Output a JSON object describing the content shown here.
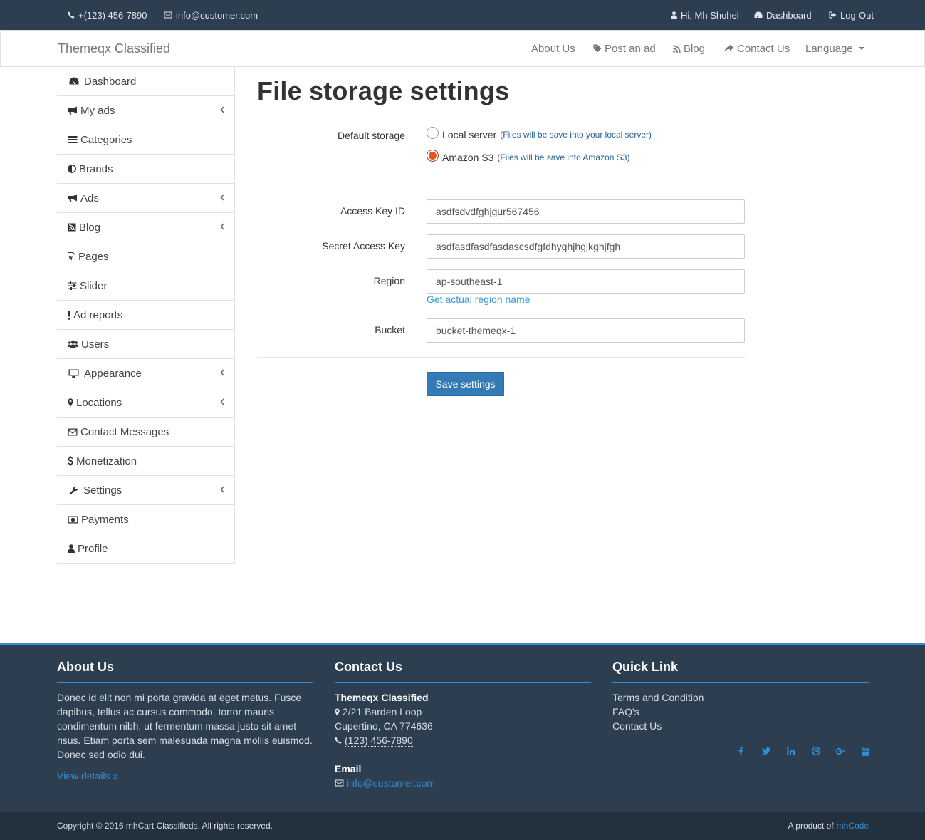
{
  "topbar": {
    "phone": "+(123) 456-7890",
    "email": "info@customer.com",
    "greeting": "Hi, Mh Shohel",
    "dashboard": "Dashboard",
    "logout": "Log-Out"
  },
  "navbar": {
    "brand": "Themeqx Classified",
    "about": "About Us",
    "post_ad": "Post an ad",
    "blog": "Blog",
    "contact": "Contact Us",
    "language": "Language"
  },
  "sidebar": {
    "items": [
      {
        "label": "Dashboard",
        "icon": "dashboard-icon"
      },
      {
        "label": "My ads",
        "icon": "bullhorn-icon"
      },
      {
        "label": "Categories",
        "icon": "list-icon"
      },
      {
        "label": "Brands",
        "icon": "adjust-icon"
      },
      {
        "label": "Ads",
        "icon": "bullhorn-icon"
      },
      {
        "label": "Blog",
        "icon": "rss-icon"
      },
      {
        "label": "Pages",
        "icon": "file-word-icon"
      },
      {
        "label": "Slider",
        "icon": "sliders-icon"
      },
      {
        "label": "Ad reports",
        "icon": "exclamation-icon"
      },
      {
        "label": "Users",
        "icon": "users-icon"
      },
      {
        "label": "Appearance",
        "icon": "desktop-icon"
      },
      {
        "label": "Locations",
        "icon": "map-marker-icon"
      },
      {
        "label": "Contact Messages",
        "icon": "envelope-icon"
      },
      {
        "label": "Monetization",
        "icon": "dollar-icon"
      },
      {
        "label": "Settings",
        "icon": "wrench-icon"
      },
      {
        "label": "Payments",
        "icon": "money-icon"
      },
      {
        "label": "Profile",
        "icon": "user-icon"
      }
    ]
  },
  "main": {
    "title": "File storage settings",
    "default_storage_label": "Default storage",
    "local_label": "Local server",
    "local_hint": "(Files will be save into your local server)",
    "s3_label": "Amazon S3",
    "s3_hint": "(Files will be save into Amazon S3)",
    "selected_storage": "Amazon S3",
    "access_key_label": "Access Key ID",
    "access_key_value": "asdfsdvdfghjgur567456",
    "secret_key_label": "Secret Access Key",
    "secret_key_value": "asdfasdfasdfasdascsdfgfdhyghjhgjkghjfgh",
    "region_label": "Region",
    "region_value": "ap-southeast-1",
    "region_help": "Get actual region name",
    "bucket_label": "Bucket",
    "bucket_value": "bucket-themeqx-1",
    "save_button": "Save settings"
  },
  "footer": {
    "about_title": "About Us",
    "about_text": "Donec id elit non mi porta gravida at eget metus. Fusce dapibus, tellus ac cursus commodo, tortor mauris condimentum nibh, ut fermentum massa justo sit amet risus. Etiam porta sem malesuada magna mollis euismod. Donec sed odio dui.",
    "about_link": "View details »",
    "contact_title": "Contact Us",
    "company": "Themeqx Classified",
    "address1": "2/21 Barden Loop",
    "address2": "Cupertino, CA 774636",
    "phone": "(123) 456-7890",
    "email_heading": "Email",
    "email": "info@customer.com",
    "quick_title": "Quick Link",
    "quick_links": [
      "Terms and Condition",
      "FAQ's",
      "Contact Us"
    ],
    "socials": [
      "facebook-icon",
      "twitter-icon",
      "linkedin-icon",
      "dribbble-icon",
      "google-plus-icon",
      "youtube-icon"
    ],
    "copyright": "Copyright © 2016 mhCart Classifieds. All rights reserved.",
    "product_prefix": "A product of",
    "product_link": "mhCode"
  },
  "colors": {
    "topbar_bg": "#2c3e50",
    "accent": "#2f8fd8",
    "button": "#337ab7",
    "radio_selected": "#e2571e"
  }
}
